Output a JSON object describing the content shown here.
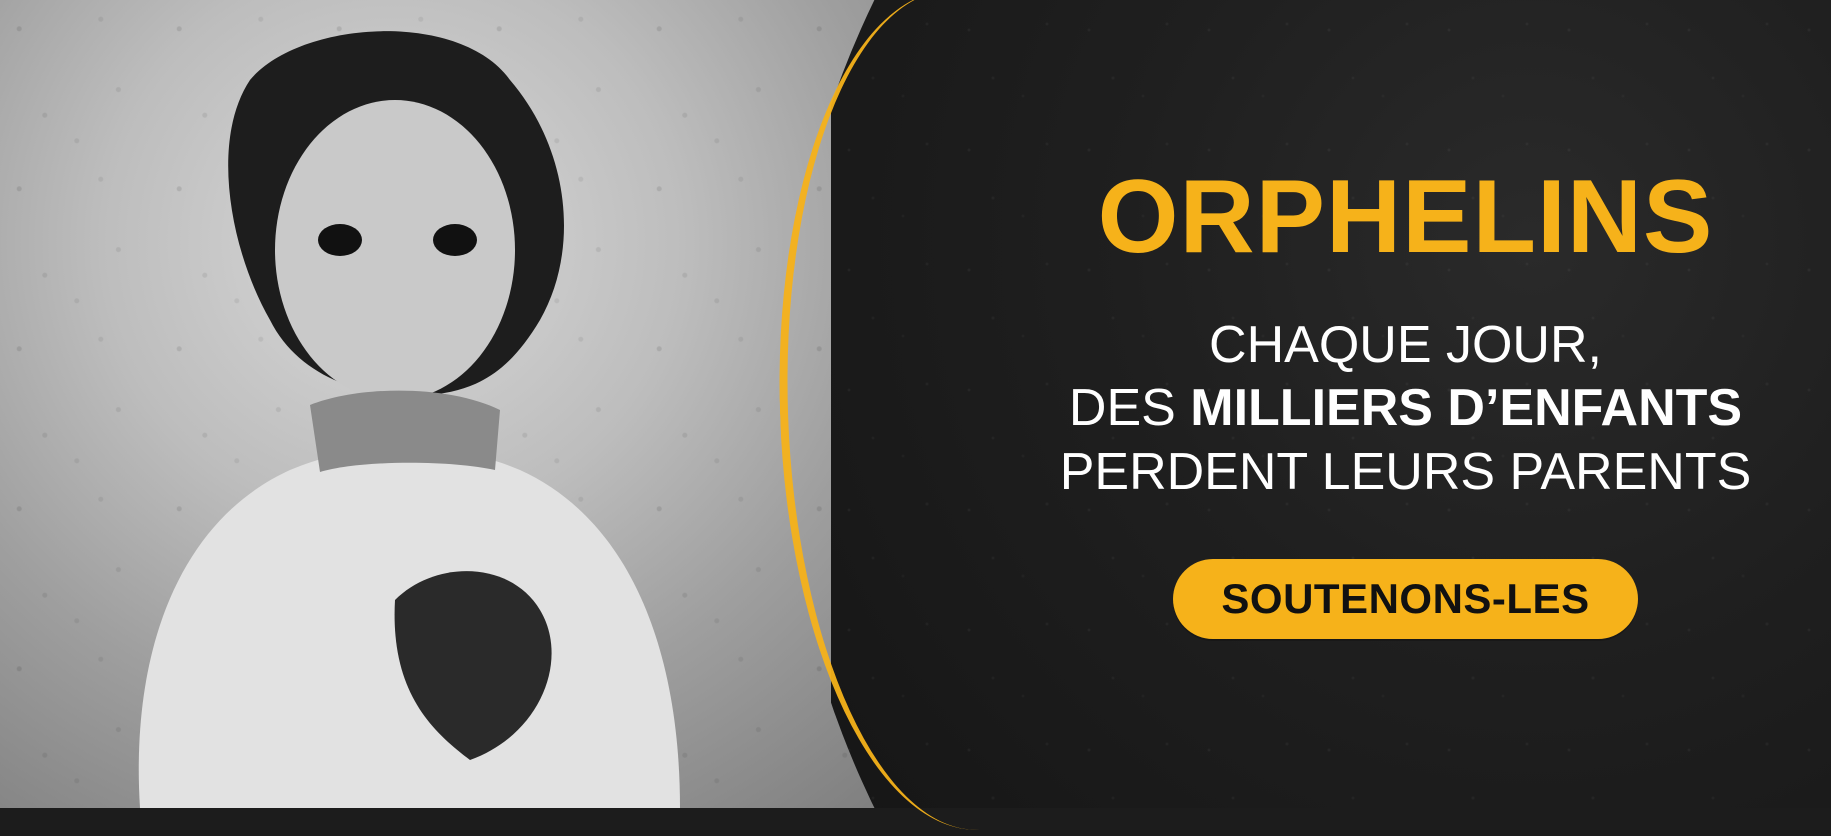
{
  "banner": {
    "title": "ORPHELINS",
    "message": {
      "line1": "CHAQUE JOUR,",
      "line2_prefix": "DES ",
      "line2_emphasis": "MILLIERS D’ENFANTS",
      "line3": "PERDENT LEURS PARENTS"
    },
    "cta_label": "SOUTENONS-LES"
  },
  "colors": {
    "accent": "#f6b21a",
    "dark_panel": "#1f1f1f",
    "text": "#ffffff"
  }
}
